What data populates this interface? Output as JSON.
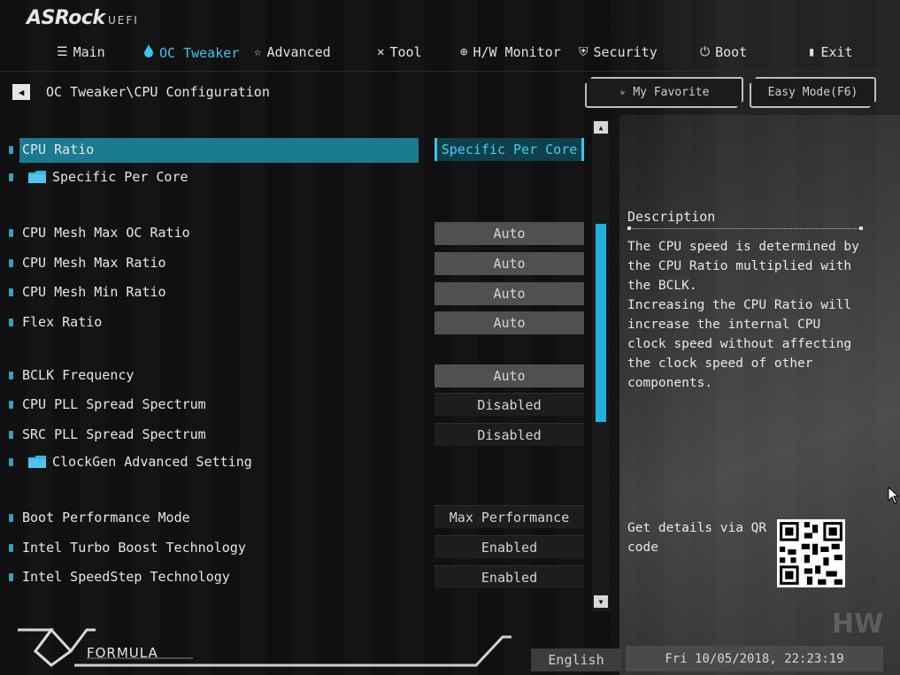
{
  "brand": {
    "logo": "ASRock",
    "sub": "UEFI"
  },
  "nav": [
    {
      "label": "Main",
      "icon": "list-icon"
    },
    {
      "label": "OC Tweaker",
      "icon": "flame-icon"
    },
    {
      "label": "Advanced",
      "icon": "star-icon"
    },
    {
      "label": "Tool",
      "icon": "tools-icon"
    },
    {
      "label": "H/W Monitor",
      "icon": "monitor-icon"
    },
    {
      "label": "Security",
      "icon": "shield-icon"
    },
    {
      "label": "Boot",
      "icon": "power-icon"
    },
    {
      "label": "Exit",
      "icon": "exit-icon"
    }
  ],
  "breadcrumb": "OC Tweaker\\CPU Configuration",
  "buttons": {
    "favorite": "My Favorite",
    "easy": "Easy Mode(F6)"
  },
  "settings": {
    "cpu_ratio": {
      "label": "CPU Ratio",
      "value": "Specific Per Core"
    },
    "specific_per_core": {
      "label": "Specific Per Core"
    },
    "mesh_max_oc": {
      "label": "CPU Mesh Max OC Ratio",
      "value": "Auto"
    },
    "mesh_max": {
      "label": "CPU Mesh Max Ratio",
      "value": "Auto"
    },
    "mesh_min": {
      "label": "CPU Mesh Min Ratio",
      "value": "Auto"
    },
    "flex": {
      "label": "Flex Ratio",
      "value": "Auto"
    },
    "bclk": {
      "label": "BCLK Frequency",
      "value": "Auto"
    },
    "cpu_pll": {
      "label": "CPU PLL Spread Spectrum",
      "value": "Disabled"
    },
    "src_pll": {
      "label": "SRC PLL Spread Spectrum",
      "value": "Disabled"
    },
    "clockgen": {
      "label": "ClockGen Advanced Setting"
    },
    "boot_perf": {
      "label": "Boot Performance Mode",
      "value": "Max Performance"
    },
    "turbo": {
      "label": "Intel Turbo Boost Technology",
      "value": "Enabled"
    },
    "speedstep": {
      "label": "Intel SpeedStep Technology",
      "value": "Enabled"
    }
  },
  "description": {
    "title": "Description",
    "body": "The CPU speed is determined by the CPU Ratio multiplied with the BCLK.\nIncreasing the CPU Ratio will increase the internal CPU clock speed without affecting the clock speed of other components."
  },
  "qr": {
    "text": "Get details via QR code"
  },
  "footer": {
    "brand": "FORMULA",
    "language": "English",
    "datetime": "Fri 10/05/2018, 22:23:19",
    "watermark": "HW"
  },
  "colors": {
    "accent": "#3ec4ec",
    "highlight": "#1a7a90",
    "scrollbar": "#1fb2e0"
  }
}
